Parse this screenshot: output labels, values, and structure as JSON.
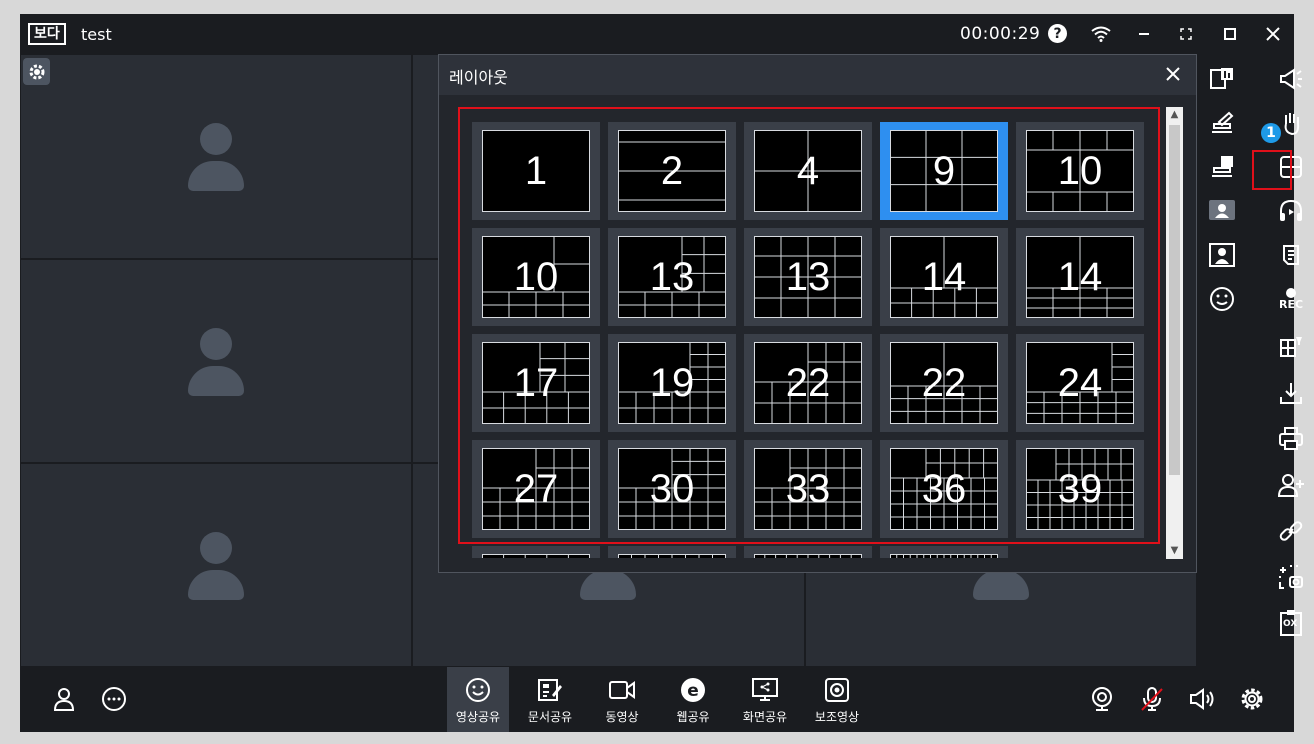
{
  "app": {
    "logo": "보다",
    "title": "test",
    "timer": "00:00:29",
    "help_glyph": "?"
  },
  "dialog": {
    "title": "레이아웃",
    "close_glyph": "✕"
  },
  "layouts": [
    {
      "label": "1"
    },
    {
      "label": "2"
    },
    {
      "label": "4"
    },
    {
      "label": "9",
      "selected": true
    },
    {
      "label": "10"
    },
    {
      "label": "10"
    },
    {
      "label": "13"
    },
    {
      "label": "13"
    },
    {
      "label": "14"
    },
    {
      "label": "14"
    },
    {
      "label": "17"
    },
    {
      "label": "19"
    },
    {
      "label": "22"
    },
    {
      "label": "22"
    },
    {
      "label": "24"
    },
    {
      "label": "27"
    },
    {
      "label": "30"
    },
    {
      "label": "33"
    },
    {
      "label": "36"
    },
    {
      "label": "39"
    }
  ],
  "sidebar": {
    "badge_count": "1",
    "rec_label": "REC",
    "ox_label": "OX"
  },
  "bottombar": {
    "buttons": [
      {
        "label": "영상공유",
        "icon": "smile-icon"
      },
      {
        "label": "문서공유",
        "icon": "document-edit-icon"
      },
      {
        "label": "동영상",
        "icon": "video-camera-icon"
      },
      {
        "label": "웹공유",
        "icon": "web-icon"
      },
      {
        "label": "화면공유",
        "icon": "screen-share-icon"
      },
      {
        "label": "보조영상",
        "icon": "secondary-camera-icon"
      }
    ]
  },
  "colors": {
    "accent": "#2e8ff0",
    "highlight": "#e0101a",
    "badge": "#1e9ae8"
  }
}
